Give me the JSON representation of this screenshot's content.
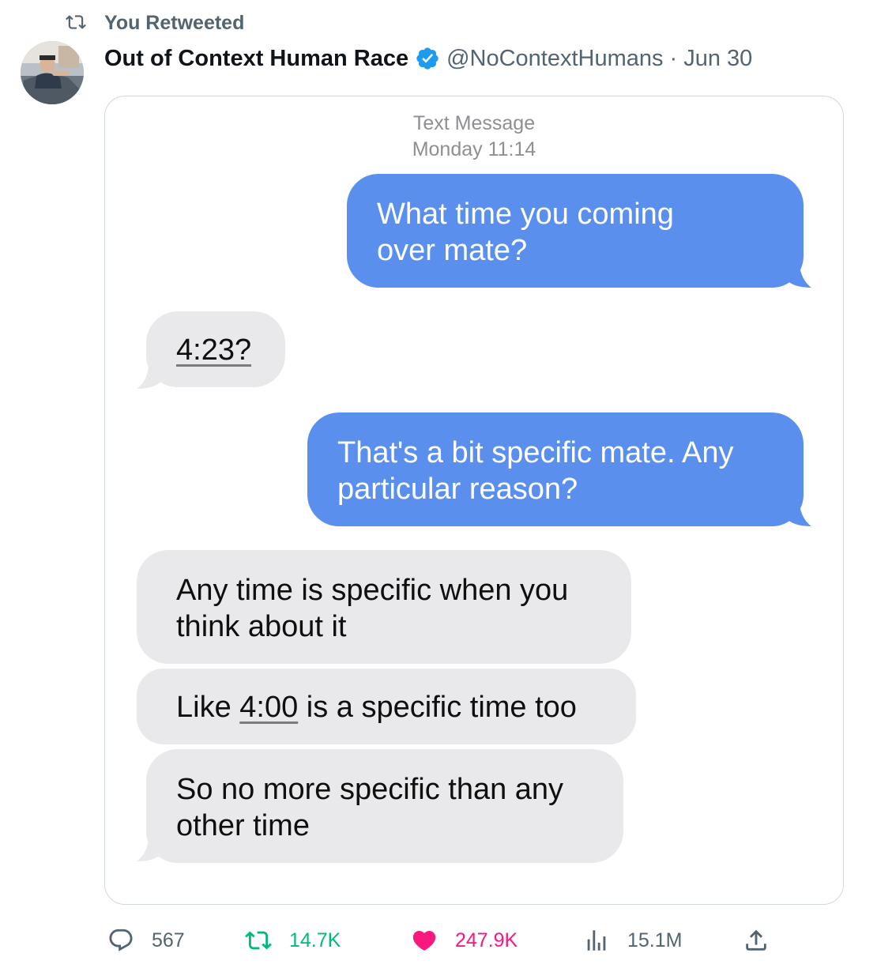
{
  "retweet_banner": {
    "label": "You Retweeted",
    "icon": "retweet-icon"
  },
  "tweet": {
    "author_name": "Out of Context Human Race",
    "verified": true,
    "handle": "@NoContextHumans",
    "separator": "·",
    "date": "Jun 30"
  },
  "screenshot": {
    "header_line1": "Text Message",
    "header_line2": "Monday 11:14",
    "messages": [
      {
        "side": "sent",
        "lines": [
          "What time you coming",
          "over mate?"
        ]
      },
      {
        "side": "received",
        "lines": [
          "4:23?"
        ]
      },
      {
        "side": "sent",
        "lines": [
          "That's a bit specific mate. Any",
          "particular reason?"
        ]
      },
      {
        "side": "received",
        "lines": [
          "Any time is specific when you",
          "think about it"
        ]
      },
      {
        "side": "received",
        "pre": "Like ",
        "underlined": "4:00",
        "post": " is a specific time too"
      },
      {
        "side": "received",
        "lines": [
          "So no more specific than any",
          "other time"
        ]
      }
    ]
  },
  "actions": {
    "replies": "567",
    "retweets": "14.7K",
    "likes": "247.9K",
    "views": "15.1M"
  },
  "colors": {
    "retweet_green": "#00ba7c",
    "like_pink": "#f91880",
    "verified_blue": "#1d9bf0",
    "sent_bubble": "#5b8fee",
    "received_bubble": "#e9e9eb"
  }
}
